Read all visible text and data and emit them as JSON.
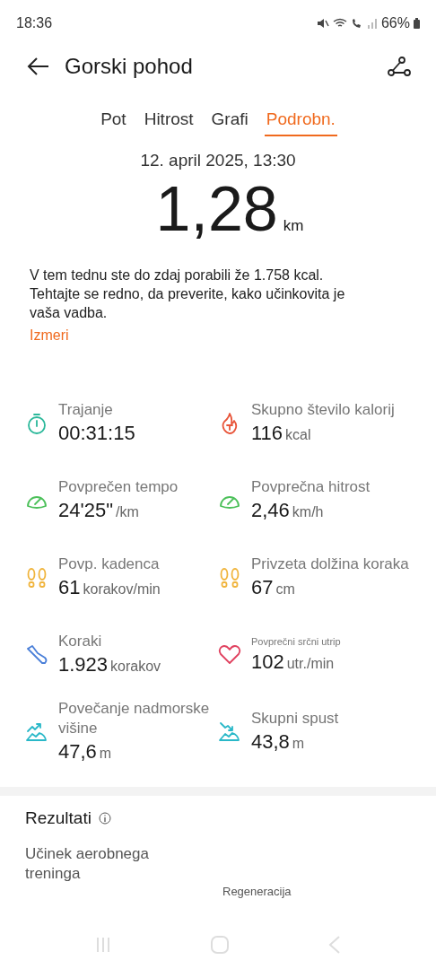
{
  "status_bar": {
    "time": "18:36",
    "battery": "66%"
  },
  "header": {
    "title": "Gorski pohod"
  },
  "tabs": [
    {
      "label": "Pot",
      "selected": false
    },
    {
      "label": "Hitrost",
      "selected": false
    },
    {
      "label": "Grafi",
      "selected": false
    },
    {
      "label": "Podrobn.",
      "selected": true
    }
  ],
  "date": "12. april 2025, 13:30",
  "distance": {
    "value": "1,28",
    "unit": "km"
  },
  "note": "V tem tednu ste do zdaj porabili že 1.758 kcal. Tehtajte se redno, da preverite, kako učinkovita je vaša vadba.",
  "measure_link": "Izmeri",
  "metrics": [
    {
      "kind": "stopwatch",
      "color": "#2bb89a",
      "label": "Trajanje",
      "value": "00:31:15",
      "small_label": false
    },
    {
      "kind": "flame",
      "color": "#e8553a",
      "label": "Skupno število kalorij",
      "value": "116",
      "unit": "kcal",
      "small_label": false
    },
    {
      "kind": "gauge",
      "color": "#4cc05a",
      "label": "Povprečen tempo",
      "value": "24'25\"",
      "unit": "/km",
      "small_label": false
    },
    {
      "kind": "gauge",
      "color": "#4cc05a",
      "label": "Povprečna hitrost",
      "value": "2,46",
      "unit": "km/h",
      "small_label": false
    },
    {
      "kind": "footprints",
      "color": "#f0b43c",
      "label": "Povp. kadenca",
      "value": "61",
      "unit": "korakov/min",
      "small_label": false
    },
    {
      "kind": "footprints",
      "color": "#f0b43c",
      "label": "Privzeta dolžina koraka",
      "value": "67",
      "unit": "cm",
      "small_label": false
    },
    {
      "kind": "shoe",
      "color": "#4a7fd8",
      "label": "Koraki",
      "value": "1.923",
      "unit": "korakov",
      "small_label": false
    },
    {
      "kind": "heart",
      "color": "#e0405e",
      "label": "Povprečni srčni utrip",
      "value": "102",
      "unit": "utr./min",
      "small_label": true
    },
    {
      "kind": "ascent",
      "color": "#2ab8c8",
      "label": "Povečanje nadmorske višine",
      "value": "47,6",
      "unit": "m",
      "small_label": false
    },
    {
      "kind": "descent",
      "color": "#2ab8c8",
      "label": "Skupni spust",
      "value": "43,8",
      "unit": "m",
      "small_label": false
    }
  ],
  "results": {
    "title": "Rezultati",
    "item": "Učinek aerobnega treninga",
    "item_2": "Regeneracija"
  }
}
